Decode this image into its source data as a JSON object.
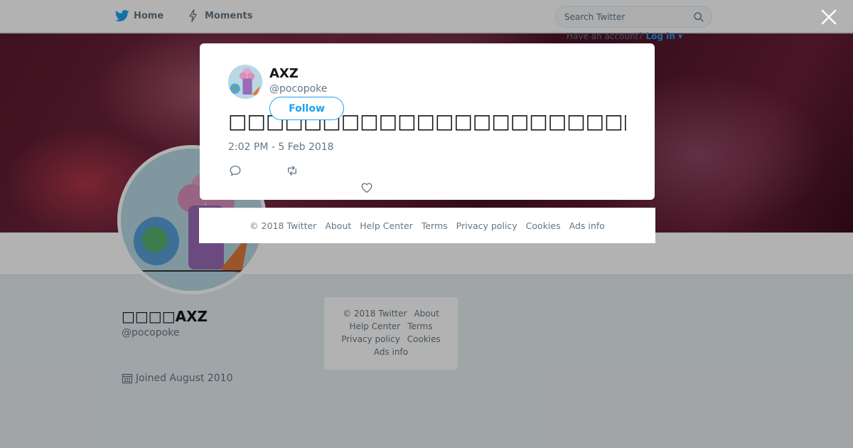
{
  "nav": {
    "home_label": "Home",
    "moments_label": "Moments",
    "search_placeholder": "Search Twitter",
    "account_prompt": "Have an account?",
    "login_label": "Log in"
  },
  "profile": {
    "name": "□□□□AXZ",
    "handle": "@pocopoke",
    "joined": "Joined August 2010"
  },
  "side_footer": {
    "copyright": "© 2018 Twitter",
    "links": [
      "About",
      "Help Center",
      "Terms",
      "Privacy policy",
      "Cookies",
      "Ads info"
    ]
  },
  "tweet": {
    "author_name": "AXZ",
    "author_handle": "@pocopoke",
    "follow_label": "Follow",
    "text": "□□□□□□□□□□□□□□□□□□□□□□□□□□□□□□□□□□□□□□□□□□□□□□□□□□□□□",
    "timestamp": "2:02 PM - 5 Feb 2018"
  },
  "modal_footer": {
    "copyright": "© 2018 Twitter",
    "links": [
      "About",
      "Help Center",
      "Terms",
      "Privacy policy",
      "Cookies",
      "Ads info"
    ]
  },
  "icons": {
    "brand": "twitter-bird-icon",
    "moments": "lightning-icon",
    "search": "search-icon",
    "close": "close-icon",
    "reply": "reply-icon",
    "retweet": "retweet-icon",
    "like": "heart-icon",
    "calendar": "calendar-icon"
  },
  "colors": {
    "accent": "#1da1f2",
    "muted_text": "#657786",
    "dark_text": "#14171a"
  }
}
